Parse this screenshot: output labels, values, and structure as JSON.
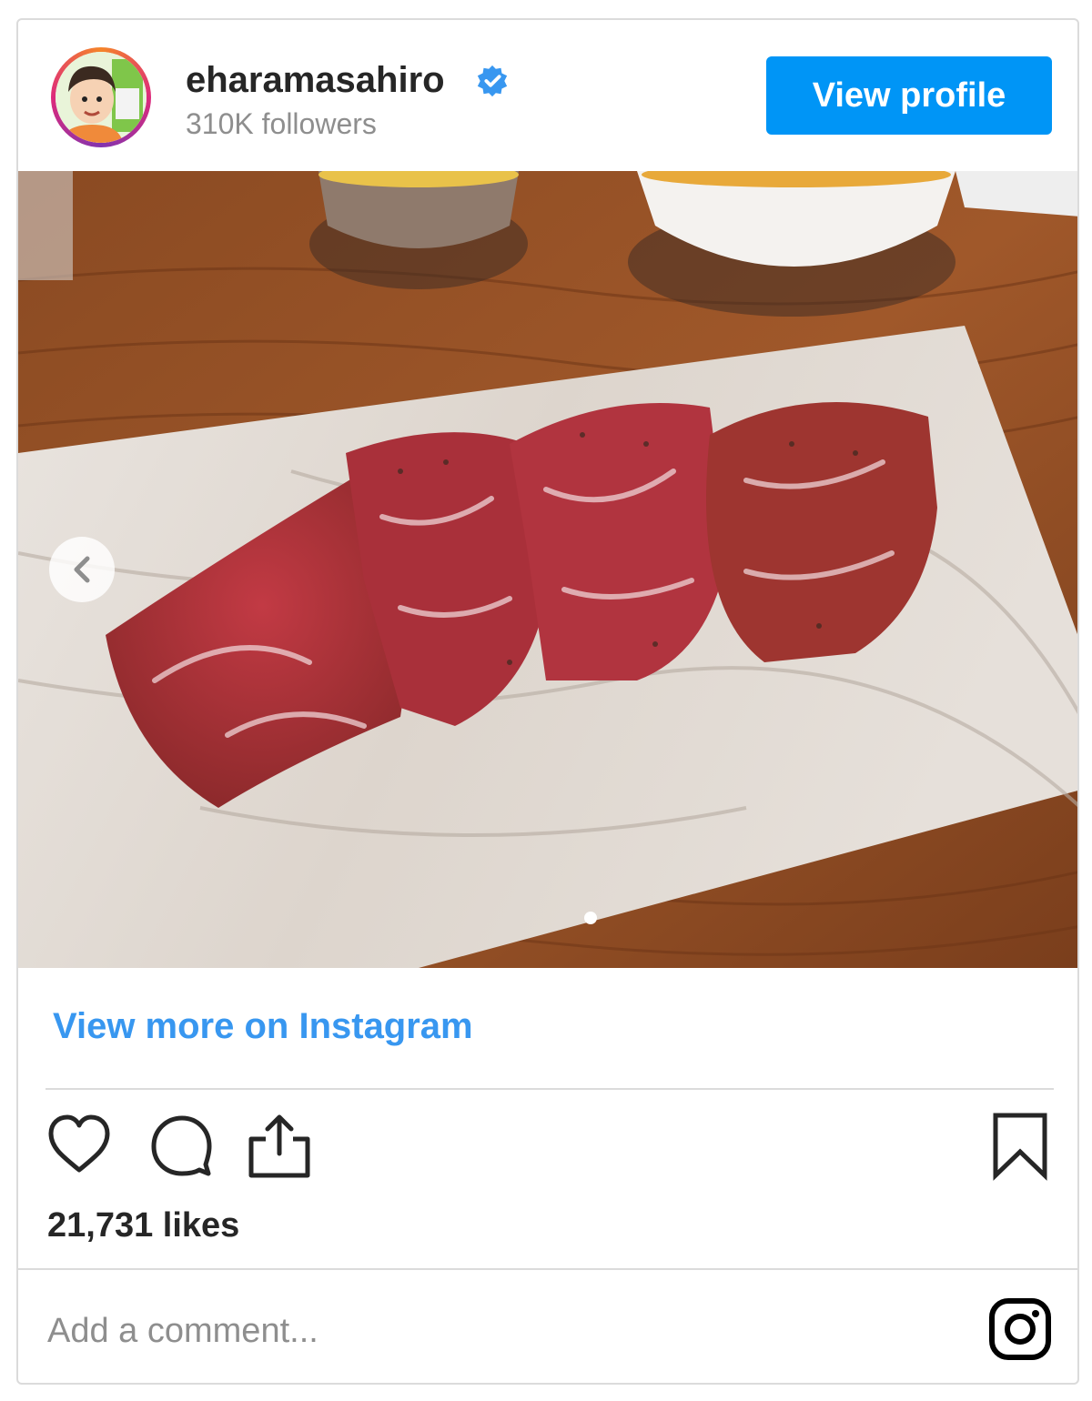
{
  "header": {
    "username": "eharamasahiro",
    "followers": "310K followers",
    "view_profile_label": "View profile"
  },
  "colors": {
    "accent": "#0095f6",
    "link": "#3897f0",
    "text": "#262626",
    "secondary_text": "#8e8e8e",
    "border": "#dbdbdb"
  },
  "post": {
    "view_more_label": "View more on Instagram",
    "likes": "21,731 likes"
  },
  "comment": {
    "placeholder": "Add a comment..."
  },
  "icons": [
    "verified-badge-icon",
    "chevron-left-icon",
    "heart-icon",
    "comment-icon",
    "share-icon",
    "bookmark-icon",
    "instagram-logo-icon"
  ]
}
